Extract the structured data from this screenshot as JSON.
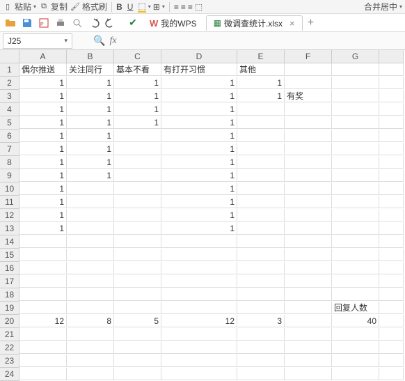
{
  "toolbar": {
    "copy": "复制",
    "paste_text": "粘贴",
    "format_painter": "格式刷",
    "merge_right": "合并居中"
  },
  "tabs": {
    "wps_home": "我的WPS",
    "file": "微调查统计.xlsx"
  },
  "namebox": {
    "ref": "J25"
  },
  "headers": [
    "A",
    "B",
    "C",
    "D",
    "E",
    "F",
    "G",
    ""
  ],
  "rows": [
    {
      "n": "1",
      "c": [
        {
          "t": "偶尔推送"
        },
        {
          "t": "关注同行"
        },
        {
          "t": "基本不看"
        },
        {
          "t": "有打开习惯"
        },
        {
          "t": "其他"
        },
        {
          "t": ""
        },
        {
          "t": ""
        },
        {
          "t": ""
        }
      ]
    },
    {
      "n": "2",
      "c": [
        {
          "v": 1
        },
        {
          "v": 1
        },
        {
          "v": 1
        },
        {
          "v": 1
        },
        {
          "v": 1
        },
        {
          "t": ""
        },
        {
          "t": ""
        },
        {
          "t": ""
        }
      ]
    },
    {
      "n": "3",
      "c": [
        {
          "v": 1
        },
        {
          "v": 1
        },
        {
          "v": 1
        },
        {
          "v": 1
        },
        {
          "v": 1
        },
        {
          "t": "有奖"
        },
        {
          "t": ""
        },
        {
          "t": ""
        }
      ]
    },
    {
      "n": "4",
      "c": [
        {
          "v": 1
        },
        {
          "v": 1
        },
        {
          "v": 1
        },
        {
          "v": 1
        },
        {
          "t": ""
        },
        {
          "t": ""
        },
        {
          "t": ""
        },
        {
          "t": ""
        }
      ]
    },
    {
      "n": "5",
      "c": [
        {
          "v": 1
        },
        {
          "v": 1
        },
        {
          "v": 1
        },
        {
          "v": 1
        },
        {
          "t": ""
        },
        {
          "t": ""
        },
        {
          "t": ""
        },
        {
          "t": ""
        }
      ]
    },
    {
      "n": "6",
      "c": [
        {
          "v": 1
        },
        {
          "v": 1
        },
        {
          "t": ""
        },
        {
          "v": 1
        },
        {
          "t": ""
        },
        {
          "t": ""
        },
        {
          "t": ""
        },
        {
          "t": ""
        }
      ]
    },
    {
      "n": "7",
      "c": [
        {
          "v": 1
        },
        {
          "v": 1
        },
        {
          "t": ""
        },
        {
          "v": 1
        },
        {
          "t": ""
        },
        {
          "t": ""
        },
        {
          "t": ""
        },
        {
          "t": ""
        }
      ]
    },
    {
      "n": "8",
      "c": [
        {
          "v": 1
        },
        {
          "v": 1
        },
        {
          "t": ""
        },
        {
          "v": 1
        },
        {
          "t": ""
        },
        {
          "t": ""
        },
        {
          "t": ""
        },
        {
          "t": ""
        }
      ]
    },
    {
      "n": "9",
      "c": [
        {
          "v": 1
        },
        {
          "v": 1
        },
        {
          "t": ""
        },
        {
          "v": 1
        },
        {
          "t": ""
        },
        {
          "t": ""
        },
        {
          "t": ""
        },
        {
          "t": ""
        }
      ]
    },
    {
      "n": "10",
      "c": [
        {
          "v": 1
        },
        {
          "t": ""
        },
        {
          "t": ""
        },
        {
          "v": 1
        },
        {
          "t": ""
        },
        {
          "t": ""
        },
        {
          "t": ""
        },
        {
          "t": ""
        }
      ]
    },
    {
      "n": "11",
      "c": [
        {
          "v": 1
        },
        {
          "t": ""
        },
        {
          "t": ""
        },
        {
          "v": 1
        },
        {
          "t": ""
        },
        {
          "t": ""
        },
        {
          "t": ""
        },
        {
          "t": ""
        }
      ]
    },
    {
      "n": "12",
      "c": [
        {
          "v": 1
        },
        {
          "t": ""
        },
        {
          "t": ""
        },
        {
          "v": 1
        },
        {
          "t": ""
        },
        {
          "t": ""
        },
        {
          "t": ""
        },
        {
          "t": ""
        }
      ]
    },
    {
      "n": "13",
      "c": [
        {
          "v": 1
        },
        {
          "t": ""
        },
        {
          "t": ""
        },
        {
          "v": 1
        },
        {
          "t": ""
        },
        {
          "t": ""
        },
        {
          "t": ""
        },
        {
          "t": ""
        }
      ]
    },
    {
      "n": "14",
      "c": [
        {
          "t": ""
        },
        {
          "t": ""
        },
        {
          "t": ""
        },
        {
          "t": ""
        },
        {
          "t": ""
        },
        {
          "t": ""
        },
        {
          "t": ""
        },
        {
          "t": ""
        }
      ]
    },
    {
      "n": "15",
      "c": [
        {
          "t": ""
        },
        {
          "t": ""
        },
        {
          "t": ""
        },
        {
          "t": ""
        },
        {
          "t": ""
        },
        {
          "t": ""
        },
        {
          "t": ""
        },
        {
          "t": ""
        }
      ]
    },
    {
      "n": "16",
      "c": [
        {
          "t": ""
        },
        {
          "t": ""
        },
        {
          "t": ""
        },
        {
          "t": ""
        },
        {
          "t": ""
        },
        {
          "t": ""
        },
        {
          "t": ""
        },
        {
          "t": ""
        }
      ]
    },
    {
      "n": "17",
      "c": [
        {
          "t": ""
        },
        {
          "t": ""
        },
        {
          "t": ""
        },
        {
          "t": ""
        },
        {
          "t": ""
        },
        {
          "t": ""
        },
        {
          "t": ""
        },
        {
          "t": ""
        }
      ]
    },
    {
      "n": "18",
      "c": [
        {
          "t": ""
        },
        {
          "t": ""
        },
        {
          "t": ""
        },
        {
          "t": ""
        },
        {
          "t": ""
        },
        {
          "t": ""
        },
        {
          "t": ""
        },
        {
          "t": ""
        }
      ]
    },
    {
      "n": "19",
      "c": [
        {
          "t": ""
        },
        {
          "t": ""
        },
        {
          "t": ""
        },
        {
          "t": ""
        },
        {
          "t": ""
        },
        {
          "t": ""
        },
        {
          "t": "回复人数"
        },
        {
          "t": ""
        }
      ]
    },
    {
      "n": "20",
      "c": [
        {
          "v": 12
        },
        {
          "v": 8
        },
        {
          "v": 5
        },
        {
          "v": 12
        },
        {
          "v": 3
        },
        {
          "t": ""
        },
        {
          "v": 40
        },
        {
          "t": ""
        }
      ]
    },
    {
      "n": "21",
      "c": [
        {
          "t": ""
        },
        {
          "t": ""
        },
        {
          "t": ""
        },
        {
          "t": ""
        },
        {
          "t": ""
        },
        {
          "t": ""
        },
        {
          "t": ""
        },
        {
          "t": ""
        }
      ]
    },
    {
      "n": "22",
      "c": [
        {
          "t": ""
        },
        {
          "t": ""
        },
        {
          "t": ""
        },
        {
          "t": ""
        },
        {
          "t": ""
        },
        {
          "t": ""
        },
        {
          "t": ""
        },
        {
          "t": ""
        }
      ]
    },
    {
      "n": "23",
      "c": [
        {
          "t": ""
        },
        {
          "t": ""
        },
        {
          "t": ""
        },
        {
          "t": ""
        },
        {
          "t": ""
        },
        {
          "t": ""
        },
        {
          "t": ""
        },
        {
          "t": ""
        }
      ]
    },
    {
      "n": "24",
      "c": [
        {
          "t": ""
        },
        {
          "t": ""
        },
        {
          "t": ""
        },
        {
          "t": ""
        },
        {
          "t": ""
        },
        {
          "t": ""
        },
        {
          "t": ""
        },
        {
          "t": ""
        }
      ]
    }
  ]
}
